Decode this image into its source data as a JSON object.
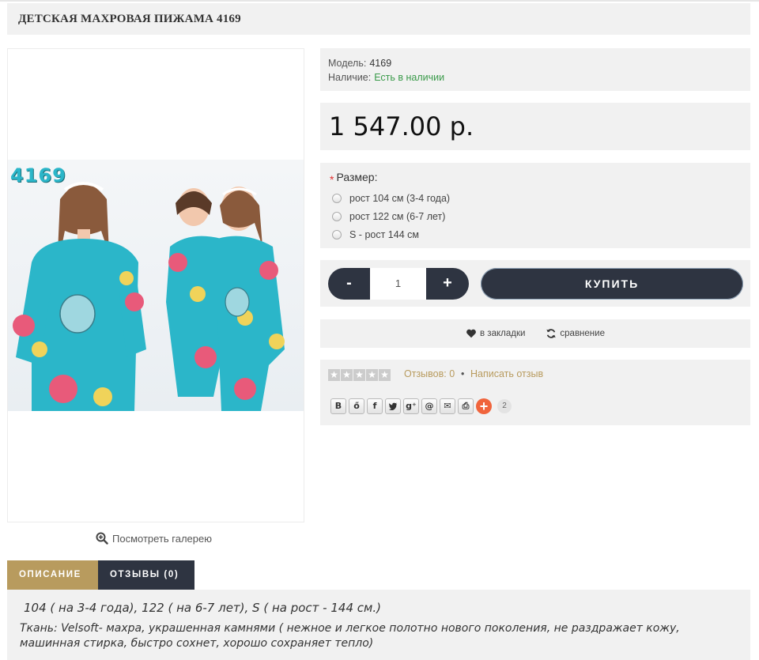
{
  "product": {
    "title": "ДЕТСКАЯ МАХРОВАЯ ПИЖАМА 4169",
    "image_badge": "4169",
    "gallery_link": "Посмотреть галерею"
  },
  "info": {
    "model_label": "Модель:",
    "model_value": "4169",
    "stock_label": "Наличие:",
    "stock_value": "Есть в наличии"
  },
  "price": "1 547.00 р.",
  "options": {
    "required_mark": "*",
    "label": "Размер:",
    "items": [
      "рост 104 см (3-4 года)",
      "рост 122 см (6-7 лет)",
      "S - рост 144 см"
    ]
  },
  "purchase": {
    "minus": "-",
    "quantity": "1",
    "plus": "+",
    "buy_label": "КУПИТЬ"
  },
  "actions": {
    "wishlist": "в закладки",
    "compare": "сравнение"
  },
  "reviews": {
    "count_text": "Отзывов: 0",
    "separator": "•",
    "write": "Написать отзыв"
  },
  "share": {
    "buttons": [
      {
        "icon": "vk-icon",
        "glyph": "В"
      },
      {
        "icon": "odnoklassniki-icon",
        "glyph": "ő"
      },
      {
        "icon": "facebook-icon",
        "glyph": "f"
      },
      {
        "icon": "twitter-icon",
        "glyph": "🐦"
      },
      {
        "icon": "google-plus-icon",
        "glyph": "g⁺"
      },
      {
        "icon": "mail-at-icon",
        "glyph": "@"
      },
      {
        "icon": "email-icon",
        "glyph": "✉"
      },
      {
        "icon": "print-icon",
        "glyph": "⎙"
      }
    ],
    "more_glyph": "+",
    "count": "2"
  },
  "tabs": {
    "description": "ОПИСАНИЕ",
    "reviews": "ОТЗЫВЫ (0)"
  },
  "description": {
    "line1": "104 ( на 3-4 года), 122 ( на 6-7 лет), S ( на рост - 144 см.)",
    "line2": "Ткань: Velsoft- махра, украшенная камнями ( нежное и легкое полотно нового поколения, не раздражает кожу, машинная стирка, быстро сохнет, хорошо сохраняет тепло)"
  },
  "colors": {
    "accent_gold": "#b89b5e",
    "dark_button": "#2e3441",
    "in_stock_green": "#3a9a4a",
    "panel_bg": "#f1f1f1"
  }
}
